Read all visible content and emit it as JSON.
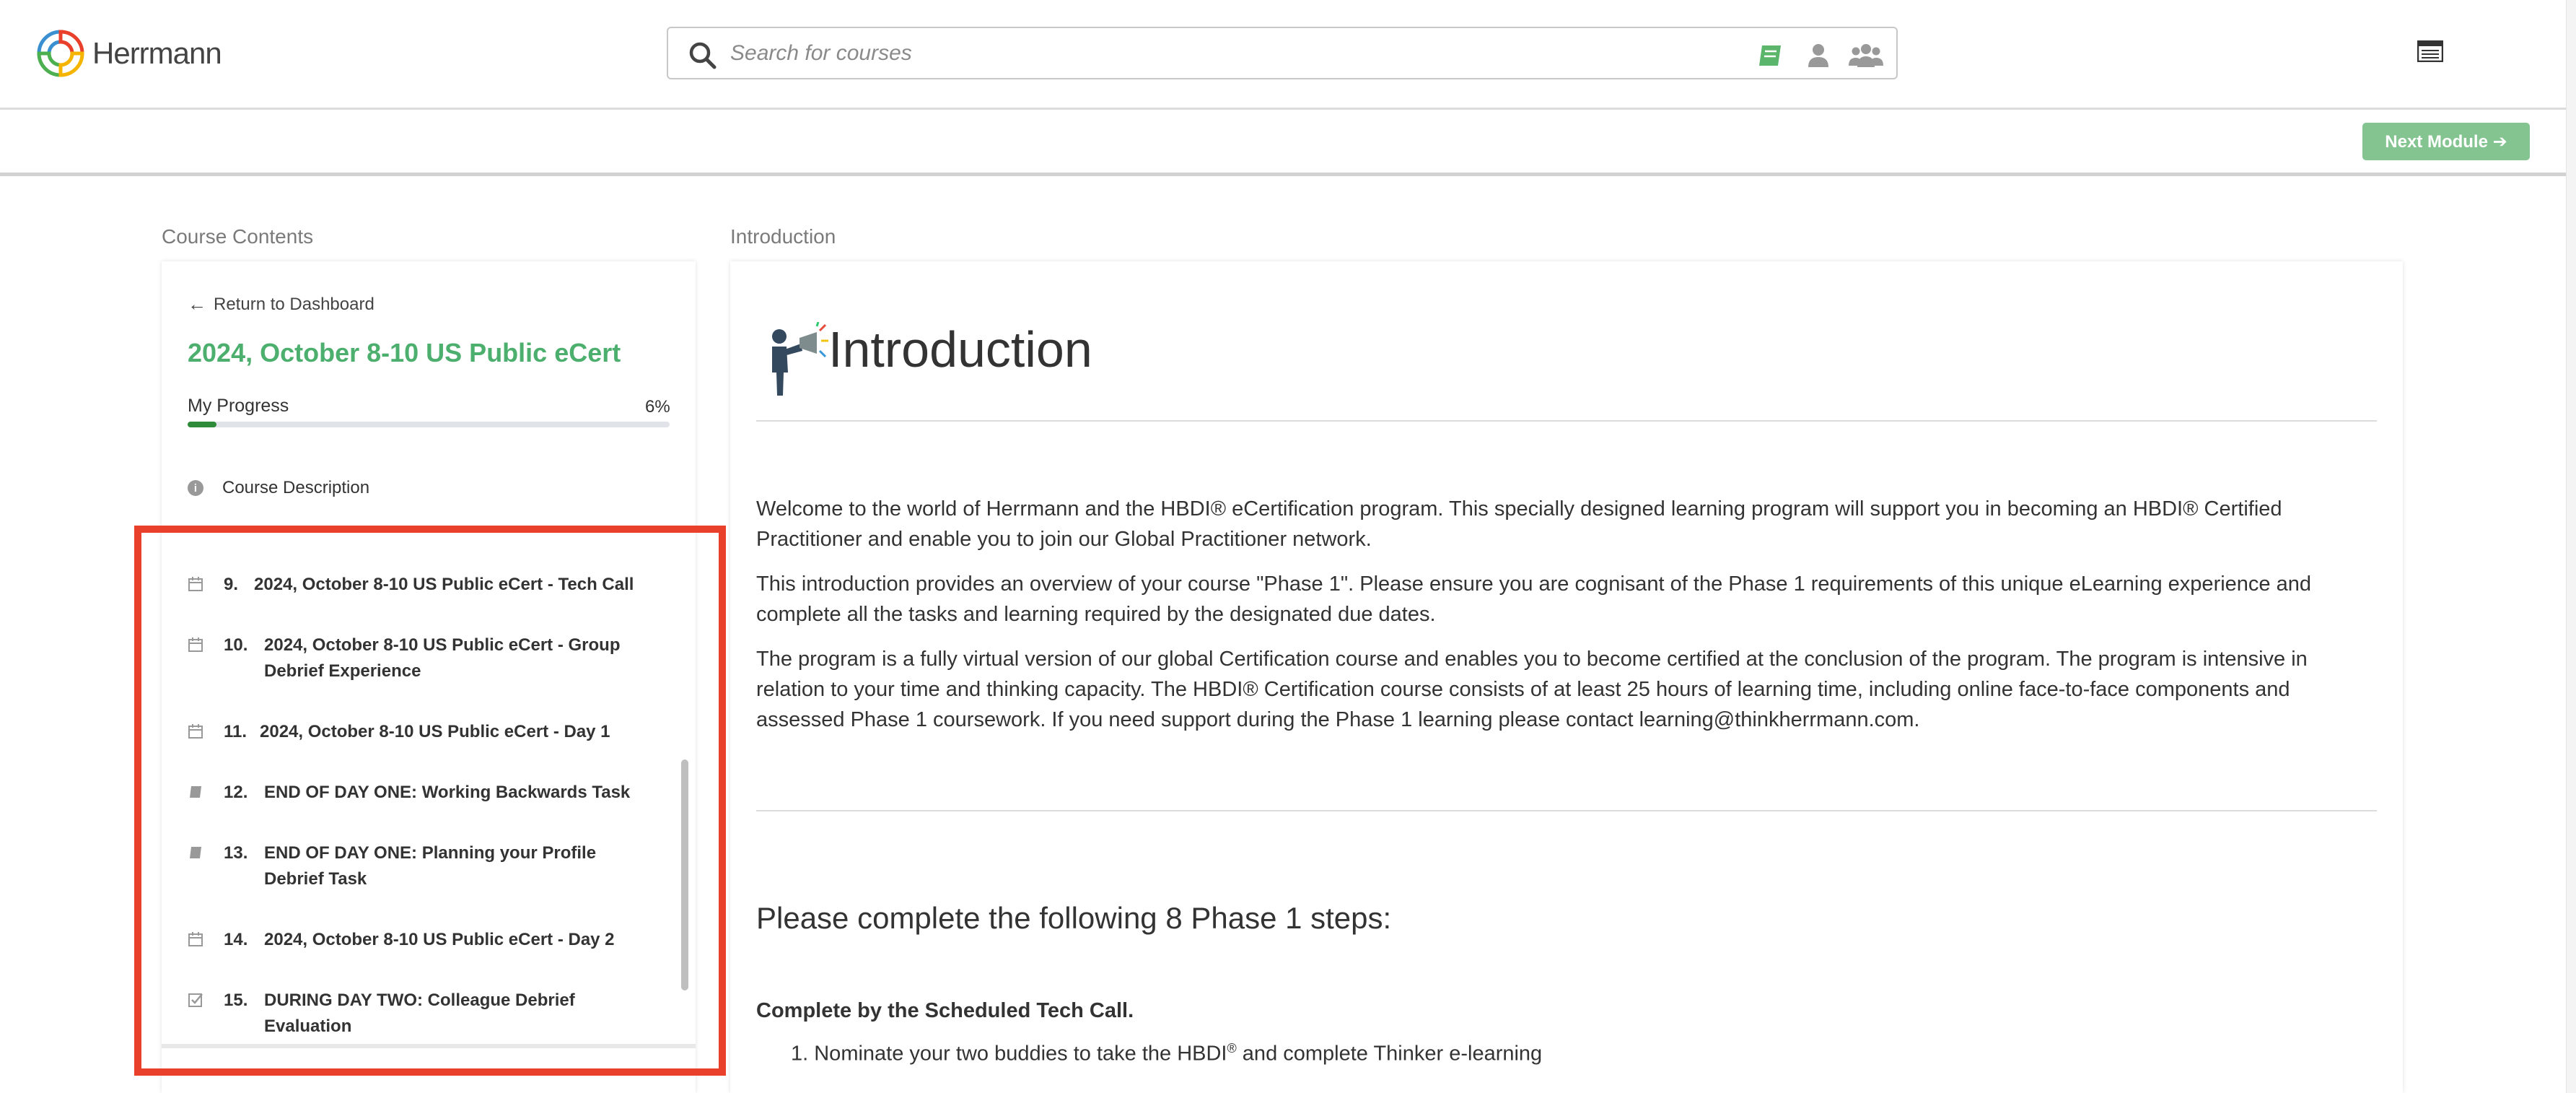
{
  "header": {
    "logo_text": "Herrmann",
    "search_placeholder": "Search for courses",
    "filter_icons": [
      "courses-book-icon",
      "user-icon",
      "group-icon"
    ],
    "next_module_label": "Next Module ➔"
  },
  "sections": {
    "left_label": "Course Contents",
    "right_label": "Introduction"
  },
  "sidebar": {
    "return_label": "Return to Dashboard",
    "course_title": "2024, October 8-10 US Public eCert",
    "progress_label": "My Progress",
    "progress_text": "6%",
    "progress_value": 0.06,
    "course_description": "Course Description",
    "items": [
      {
        "num": "9.",
        "label": "2024, October 8-10 US Public eCert - Tech Call",
        "icon": "calendar-icon"
      },
      {
        "num": "10.",
        "label": "2024, October 8-10 US Public eCert - Group Debrief Experience",
        "icon": "calendar-icon"
      },
      {
        "num": "11.",
        "label": "2024, October 8-10 US Public eCert - Day 1",
        "icon": "calendar-icon"
      },
      {
        "num": "12.",
        "label": "END OF DAY ONE: Working Backwards Task",
        "icon": "book-icon"
      },
      {
        "num": "13.",
        "label": "END OF DAY ONE: Planning your Profile Debrief Task",
        "icon": "book-icon"
      },
      {
        "num": "14.",
        "label": "2024, October 8-10 US Public eCert - Day 2",
        "icon": "calendar-icon"
      },
      {
        "num": "15.",
        "label": "DURING DAY TWO: Colleague Debrief Evaluation",
        "icon": "checkbox-icon"
      }
    ]
  },
  "main": {
    "title": "Introduction",
    "paragraphs": [
      "Welcome to the world of Herrmann and the HBDI® eCertification program. This specially designed learning program will support you in becoming an HBDI® Certified Practitioner and enable you to join our Global Practitioner network.",
      "This introduction provides an overview of your course \"Phase 1\". Please ensure you are cognisant of the Phase 1 requirements of this unique eLearning experience and complete all the tasks and learning required by the designated due dates.",
      "The program is a fully virtual version of our global Certification course and enables you to become certified at the conclusion of the program. The program is intensive in relation to your time and thinking capacity. The HBDI® Certification course consists of at least 25 hours of learning time, including online face-to-face components and assessed Phase 1 coursework. If you need support during the Phase 1 learning please contact learning@thinkherrmann.com."
    ],
    "steps_heading": "Please complete the following 8 Phase 1 steps:",
    "complete_by": "Complete by the Scheduled Tech Call.",
    "step1_prefix": "1. Nominate your two buddies to take the HBDI",
    "step1_sup": "®",
    "step1_suffix": " and complete Thinker e-learning"
  },
  "colors": {
    "accent_green": "#4caf6e",
    "highlight_red": "#e8402b",
    "next_button": "#84c490"
  }
}
